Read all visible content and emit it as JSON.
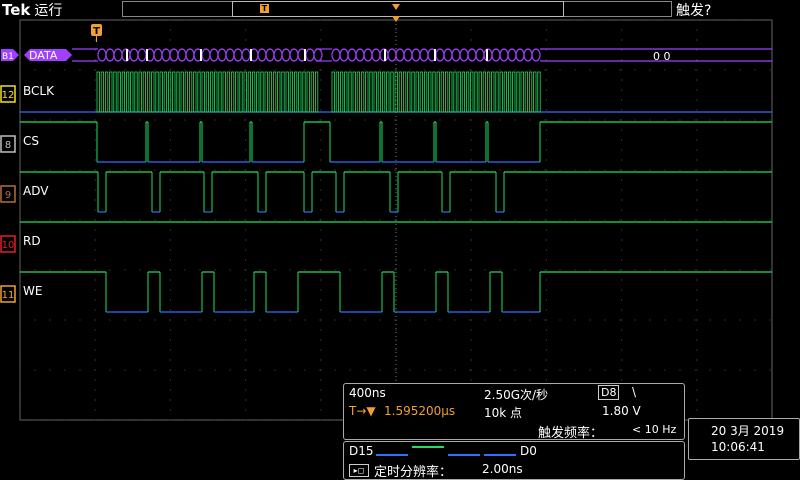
{
  "header": {
    "brand": "Tek",
    "status": "运行",
    "trigger_state": "触发?"
  },
  "trigger_marker": "T",
  "bus": {
    "indicator": "B1",
    "name": "DATA",
    "value": "0 0"
  },
  "channels": [
    {
      "indicator": "12",
      "name": "BCLK",
      "color": "#f0e020"
    },
    {
      "indicator": "8",
      "name": "CS",
      "color": "#c0c0c0"
    },
    {
      "indicator": "9",
      "name": "ADV",
      "color": "#b07040"
    },
    {
      "indicator": "10",
      "name": "RD",
      "color": "#e02020"
    },
    {
      "indicator": "11",
      "name": "WE",
      "color": "#f0a030"
    }
  ],
  "horizontal": {
    "time_per_div": "400ns",
    "sample_rate": "2.50G次/秒",
    "trigger_pos_icon": "T→▼",
    "trigger_position": "1.595200μs",
    "record_length": "10k 点"
  },
  "trigger": {
    "source": "D8",
    "slope_icon": "\\",
    "level": "1.80 V",
    "freq_label": "触发频率：",
    "freq_value": "< 10 Hz"
  },
  "digital": {
    "label_high": "D15",
    "label_low": "D0",
    "resolution_label": "定时分辨率：",
    "resolution_value": "2.00ns"
  },
  "datetime": {
    "date": "20 3月 2019",
    "time": "10:06:41"
  },
  "colors": {
    "grid": "#666666",
    "trace": "#20e060",
    "trace_low": "#3070ff",
    "bus": "#a040ff",
    "accent": "#f0a030"
  }
}
